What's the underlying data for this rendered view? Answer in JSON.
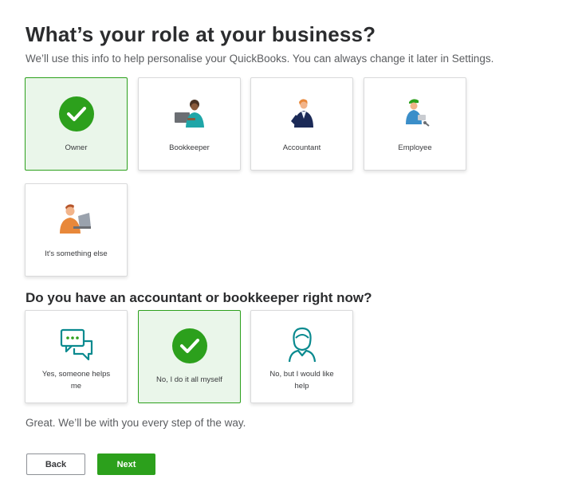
{
  "header": {
    "title": "What’s your role at your business?",
    "subtitle": "We’ll use this info to help personalise your QuickBooks. You can always change it later in Settings."
  },
  "role_section": {
    "options": [
      {
        "label": "Owner",
        "selected": true,
        "icon": "check-icon"
      },
      {
        "label": "Bookkeeper",
        "selected": false,
        "icon": "bookkeeper-illustration"
      },
      {
        "label": "Accountant",
        "selected": false,
        "icon": "accountant-illustration"
      },
      {
        "label": "Employee",
        "selected": false,
        "icon": "employee-illustration"
      },
      {
        "label": "It's something else",
        "selected": false,
        "icon": "laptop-person-illustration"
      }
    ]
  },
  "accountant_section": {
    "question": "Do you have an accountant or bookkeeper right now?",
    "options": [
      {
        "label": "Yes, someone helps me",
        "selected": false,
        "icon": "chat-bubbles-icon"
      },
      {
        "label": "No, I do it all myself",
        "selected": true,
        "icon": "check-icon"
      },
      {
        "label": "No, but I would like help",
        "selected": false,
        "icon": "person-outline-icon"
      }
    ]
  },
  "note": "Great. We’ll be with you every step of the way.",
  "footer": {
    "back_label": "Back",
    "next_label": "Next"
  },
  "colors": {
    "accent": "#2ca01c",
    "selected_bg": "#eaf6ea",
    "teal_icon": "#0a8a8f"
  }
}
